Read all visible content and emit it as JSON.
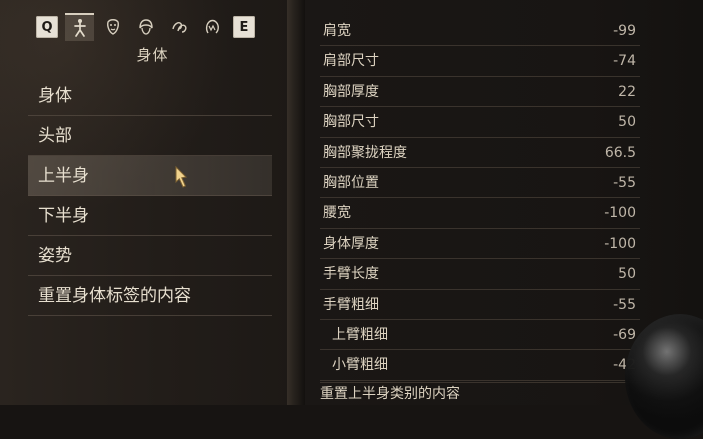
{
  "tabs": [
    {
      "label": "Q",
      "icon": "q-key-icon",
      "kind": "key"
    },
    {
      "label": "",
      "icon": "body-icon",
      "kind": "tab",
      "active": true
    },
    {
      "label": "",
      "icon": "face-icon",
      "kind": "tab"
    },
    {
      "label": "",
      "icon": "hair-icon",
      "kind": "tab"
    },
    {
      "label": "",
      "icon": "eyes-icon",
      "kind": "tab"
    },
    {
      "label": "",
      "icon": "skin-icon",
      "kind": "tab"
    },
    {
      "label": "E",
      "icon": "e-key-icon",
      "kind": "key"
    }
  ],
  "section_title": "身体",
  "menu": {
    "items": [
      {
        "label": "身体",
        "selected": false
      },
      {
        "label": "头部",
        "selected": false
      },
      {
        "label": "上半身",
        "selected": true
      },
      {
        "label": "下半身",
        "selected": false
      },
      {
        "label": "姿势",
        "selected": false
      },
      {
        "label": "重置身体标签的内容",
        "selected": false
      }
    ]
  },
  "settings": {
    "rows": [
      {
        "label": "肩宽",
        "value": "-99"
      },
      {
        "label": "肩部尺寸",
        "value": "-74"
      },
      {
        "label": "胸部厚度",
        "value": "22"
      },
      {
        "label": "胸部尺寸",
        "value": "50"
      },
      {
        "label": "胸部聚拢程度",
        "value": "66.5"
      },
      {
        "label": "胸部位置",
        "value": "-55"
      },
      {
        "label": "腰宽",
        "value": "-100"
      },
      {
        "label": "身体厚度",
        "value": "-100"
      },
      {
        "label": "手臂长度",
        "value": "50"
      },
      {
        "label": "手臂粗细",
        "value": "-55"
      },
      {
        "label": "上臂粗细",
        "value": "-69",
        "sub": true
      },
      {
        "label": "小臂粗细",
        "value": "-42",
        "sub": true
      }
    ],
    "reset_label": "重置上半身类别的内容"
  }
}
